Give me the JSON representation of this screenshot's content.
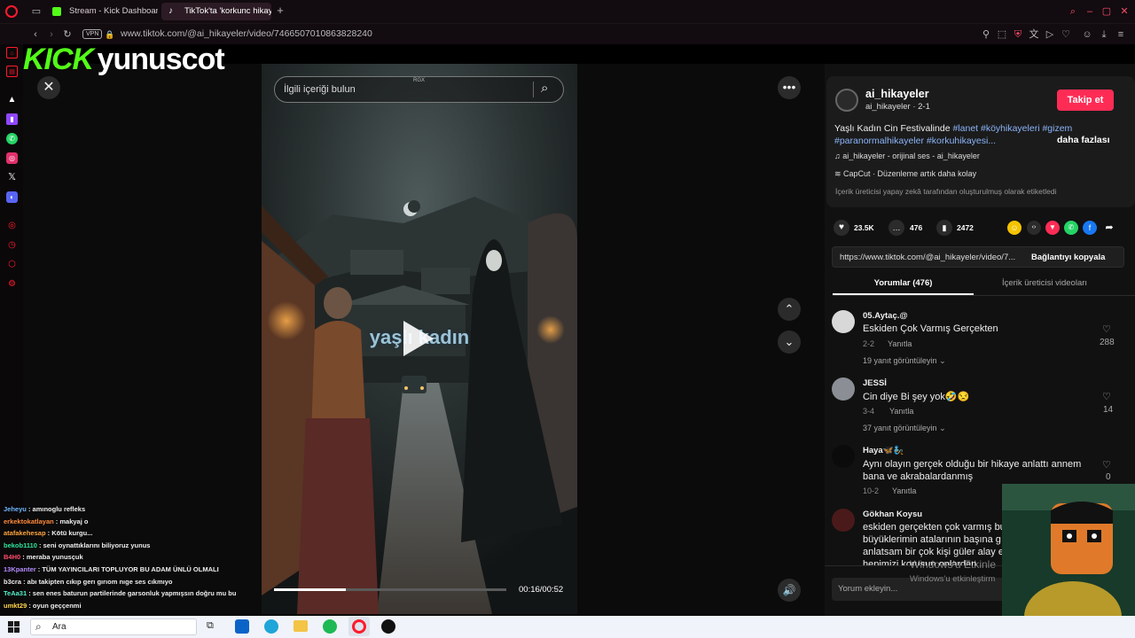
{
  "browser": {
    "tabs": [
      {
        "label": "Stream - Kick Dashboard"
      },
      {
        "label": "TikTok'ta 'korkunc hikaye"
      }
    ],
    "vpn_label": "VPN",
    "url": "www.tiktok.com/@ai_hikayeler/video/7466507010863828240"
  },
  "overlay": {
    "kick_logo": "KICK",
    "streamer": "yunuscot"
  },
  "search": {
    "placeholder": "İlgili içeriği bulun",
    "tag": "RGX"
  },
  "video": {
    "caption_overlay": "yaşlı kadın",
    "time": "00:16/00:52",
    "progress": 0.31
  },
  "post": {
    "username": "ai_hikayeler",
    "subline": "ai_hikayeler · 2-1",
    "follow_label": "Takip et",
    "desc_text": "Yaşlı Kadın Cin Festivalinde ",
    "hashtags1": "#lanet #köyhikayeleri #gizem",
    "hashtags2": "#paranormalhikayeler #korkuhikayesi...",
    "more_label": "daha fazlası",
    "sound": "ai_hikayeler - orijinal ses - ai_hikayeler",
    "capcut": "CapCut · Düzenleme artık daha kolay",
    "ai_notice": "İçerik üreticisi yapay zekâ tarafından oluşturulmuş olarak etiketledi",
    "likes": "23.5K",
    "comments": "476",
    "saves": "2472",
    "link": "https://www.tiktok.com/@ai_hikayeler/video/7...",
    "copy_label": "Bağlantıyı kopyala",
    "tab_comments": "Yorumlar (476)",
    "tab_videos": "İçerik üreticisi videoları",
    "comment_placeholder": "Yorum ekleyin..."
  },
  "comments": [
    {
      "user": "05.Aytaç.@",
      "text": "Eskiden Çok Varmış Gerçekten",
      "date": "2-2",
      "reply": "Yanıtla",
      "likes": "288",
      "more": "19 yanıt görüntüleyin"
    },
    {
      "user": "JESSİ",
      "text": "Cin diye Bi şey yok🤣😒",
      "date": "3-4",
      "reply": "Yanıtla",
      "likes": "14",
      "more": "37 yanıt görüntüleyin"
    },
    {
      "user": "Haya🦋🧞",
      "text": "Aynı olayın gerçek olduğu bir hikaye anlattı annem bana ve akrabalardanmış",
      "date": "10-2",
      "reply": "Yanıtla",
      "likes": "0",
      "more": ""
    },
    {
      "user": "Gökhan Koysu",
      "text": "eskiden gerçekten çok varmış bu büyüklerimin atalarının başına g anlatsam bir çok kişi güler alay e hepimizi korusun onlardan",
      "date": "",
      "reply": "",
      "likes": "",
      "more": ""
    }
  ],
  "windows_watermark": {
    "line1": "Windows'u Etkinle",
    "line2": "Windows'u etkinleştirm"
  },
  "chat": [
    {
      "user": "Jeheyu",
      "msg": "amınoglu refleks",
      "color": "#6fb7ff"
    },
    {
      "user": "erkektokatlayan",
      "msg": "makyaj o",
      "color": "#ff8a3c"
    },
    {
      "user": "atafakehesap",
      "msg": "Kötü kurgu...",
      "color": "#ffa43c"
    },
    {
      "user": "bekob1110",
      "msg": "seni oynattıklarını biliyoruz yunus",
      "color": "#2ee59d"
    },
    {
      "user": "B4H0",
      "msg": "meraba yunusçuk",
      "color": "#ff4d6a"
    },
    {
      "user": "13Kpanter",
      "msg": "TÜM YAYINCILARI TOPLUYOR BU ADAM ÜNLÜ OLMALI",
      "color": "#b58cff"
    },
    {
      "user": "b3cra",
      "msg": "abı takipten cıkıp gerı gırıom nıge ses cıkmıyo",
      "color": "#eeeeee"
    },
    {
      "user": "TeAa31",
      "msg": "sen enes baturun partilerinde garsonluk yapmışsın doğru mu bu",
      "color": "#53f0c8"
    },
    {
      "user": "umkt29",
      "msg": "oyun geççenmi",
      "color": "#ffd84a"
    }
  ],
  "taskbar": {
    "search_label": "Ara"
  },
  "colors": {
    "accent_pink": "#fe2c55",
    "kick_green": "#53fc18",
    "hashtag_blue": "#8ab4f8",
    "opera_red": "#ff1b2d"
  }
}
